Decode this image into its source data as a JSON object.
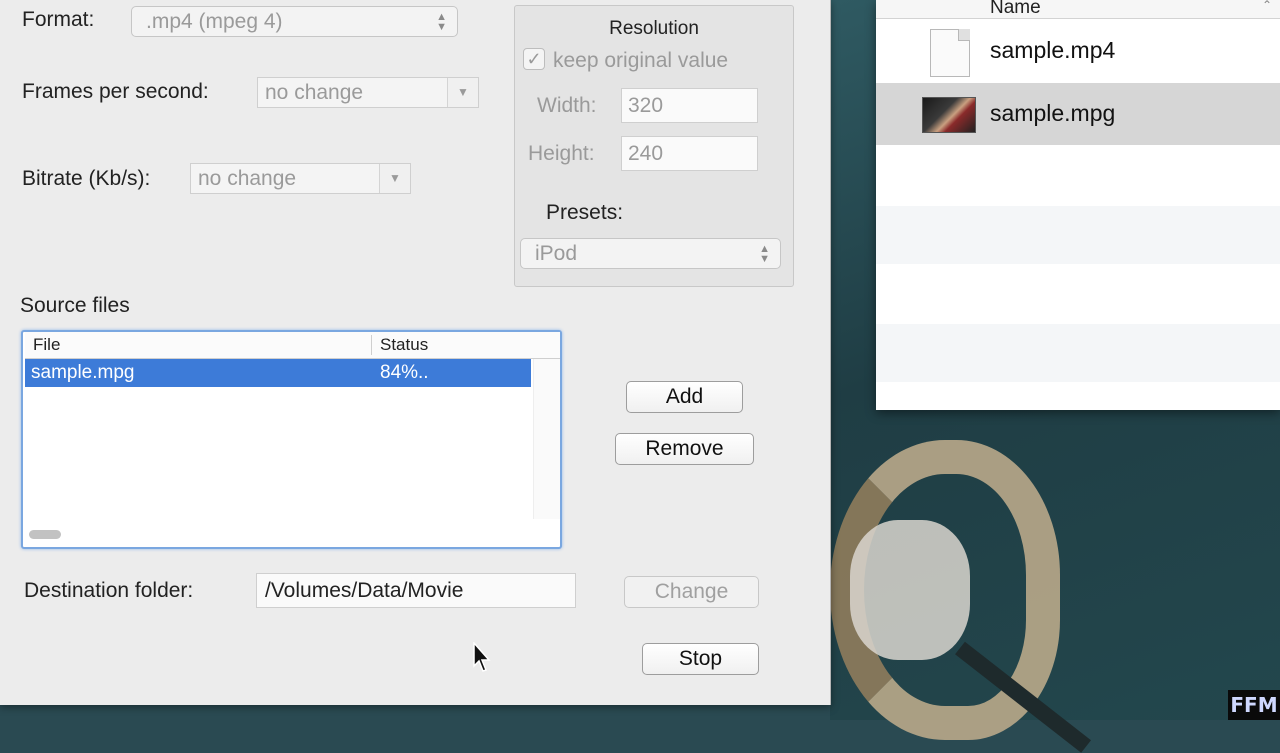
{
  "settings": {
    "format_label": "Format:",
    "format_value": ".mp4 (mpeg 4)",
    "fps_label": "Frames per second:",
    "fps_value": "no change",
    "bitrate_label": "Bitrate (Kb/s):",
    "bitrate_value": "no change"
  },
  "resolution": {
    "title": "Resolution",
    "keep_original_label": "keep original value",
    "keep_original_checked": true,
    "width_label": "Width:",
    "width_value": "320",
    "height_label": "Height:",
    "height_value": "240",
    "presets_label": "Presets:",
    "presets_value": "iPod"
  },
  "source": {
    "section_label": "Source files",
    "columns": [
      "File",
      "Status"
    ],
    "rows": [
      {
        "file": "sample.mpg",
        "status": "84%.."
      }
    ]
  },
  "buttons": {
    "add": "Add",
    "remove": "Remove",
    "change": "Change",
    "stop": "Stop"
  },
  "destination": {
    "label": "Destination folder:",
    "value": "/Volumes/Data/Movie"
  },
  "finder": {
    "column_name": "Name",
    "files": [
      {
        "name": "sample.mp4",
        "icon": "document-icon",
        "selected": false
      },
      {
        "name": "sample.mpg",
        "icon": "video-thumbnail-icon",
        "selected": true
      }
    ]
  },
  "watermark": "FFM",
  "colors": {
    "selection": "#3d7bd8",
    "focus_ring": "#7aa7e0"
  }
}
